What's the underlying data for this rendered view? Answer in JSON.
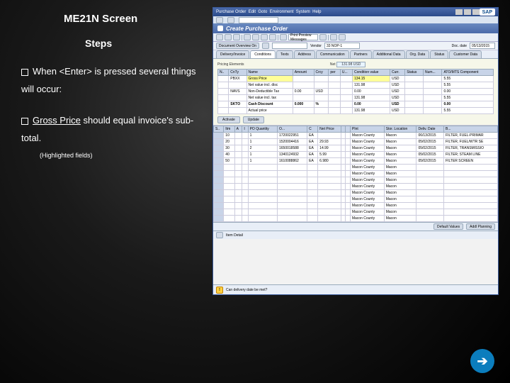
{
  "slide": {
    "title": "ME21N Screen",
    "steps_label": "Steps",
    "bullet1": "When  <Enter> is pressed several things will occur:",
    "bullet2a": "Gross Price",
    "bullet2b": " should equal invoice's sub-total.",
    "note": "(Highlighted fields)",
    "next_glyph": "➔"
  },
  "sap": {
    "title_menu": [
      "Purchase Order",
      "Edit",
      "Goto",
      "Environment",
      "System",
      "Help"
    ],
    "logo": "SAP",
    "subhead": "Create Purchase Order",
    "toolbar_text": "Print Preview    Messages",
    "doc_overview_btn": "Document Overview On",
    "header_label": "Vendor",
    "vendor_value": "33 NOP-1",
    "doc_date_label": "Doc. date",
    "doc_date_value": "05/13/2015",
    "tabs": [
      "Delivery/Invoice",
      "Conditions",
      "Texts",
      "Address",
      "Communication",
      "Partners",
      "Additional Data",
      "Org. Data",
      "Status",
      "Customer Data"
    ],
    "active_tab": 1,
    "cond_head_label": "Pricing Elements",
    "net_label": "Net",
    "net_value": "131.98",
    "net_curr": "USD",
    "cond_cols": [
      "N..",
      "CnTy",
      "Name",
      "Amount",
      "Crcy",
      "per",
      "U...",
      "Condition value",
      "Curr.",
      "Status",
      "Num...",
      "ATO/MTS Component"
    ],
    "cond_rows": [
      {
        "cnty": "PBXX",
        "name": "Gross Price",
        "amount": "",
        "crcy": "",
        "per": "",
        "u": "",
        "val": "134.15",
        "curr": "USD",
        "r": "5.55"
      },
      {
        "name": "Net value incl. disc",
        "val": "131.98",
        "curr": "USD",
        "r": "5.55"
      },
      {
        "cnty": "NAVS",
        "name": "Non-Deductible Tax",
        "amount": "0.00",
        "crcy": "USD",
        "val": "0.00",
        "curr": "USD",
        "r": "0.00"
      },
      {
        "name": "Net value incl. tax",
        "val": "131.98",
        "curr": "USD",
        "r": "5.55"
      },
      {
        "cnty": "SKTO",
        "name": "Cash Discount",
        "amount": "0.000",
        "crcy": "%",
        "val": "0.00",
        "curr": "USD",
        "r": "0.00",
        "tot": true
      },
      {
        "name": "Actual price",
        "val": "131.98",
        "curr": "USD",
        "r": "5.55"
      }
    ],
    "cond_btn1": "Activate",
    "cond_btn2": "Update",
    "item_cols": [
      "S..",
      "Itm",
      "A",
      "I",
      "PO Quantity",
      "O...",
      "C",
      "Net Price",
      "",
      "",
      "PInt",
      "Stor. Location",
      "Deliv. Date",
      "B..."
    ],
    "item_rows": [
      {
        "itm": "10",
        "qty": "1",
        "mat": "1720022951",
        "u": "EA",
        "plnt": "Macon County",
        "stor": "Macon",
        "date": "06/13/2015",
        "desc": "FILTER, FUEL-PRIMAR"
      },
      {
        "itm": "20",
        "qty": "1",
        "mat": "1520004416",
        "u": "EA",
        "price": "29.93",
        "plnt": "Macon County",
        "stor": "Macon",
        "date": "05/02/2015",
        "desc": "FILTER, FUEL/WTR SE"
      },
      {
        "itm": "30",
        "qty": "2",
        "mat": "1650018588",
        "u": "EA",
        "price": "14.99",
        "plnt": "Macon County",
        "stor": "Macon",
        "date": "05/02/2015",
        "desc": "FILTER, TRANSMISSIO"
      },
      {
        "itm": "40",
        "qty": "1",
        "mat": "1340124932",
        "u": "EA",
        "price": "5.99",
        "plnt": "Macon County",
        "stor": "Macon",
        "date": "05/02/2015",
        "desc": "FILTER; STEAM LINE"
      },
      {
        "itm": "50",
        "qty": "1",
        "mat": "1610088862",
        "u": "EA",
        "price": "6.980",
        "plnt": "Macon County",
        "stor": "Macon",
        "date": "05/02/2015",
        "desc": "FILTER SCREEN"
      }
    ],
    "empty_rows_plnt": "Macon County",
    "empty_rows_stor": "Macon",
    "detail_btn1": "Default Values",
    "detail_btn2": "Addl Planning",
    "item_detail_label": "Item Detail",
    "status_text": "Can delivery date be met?"
  }
}
